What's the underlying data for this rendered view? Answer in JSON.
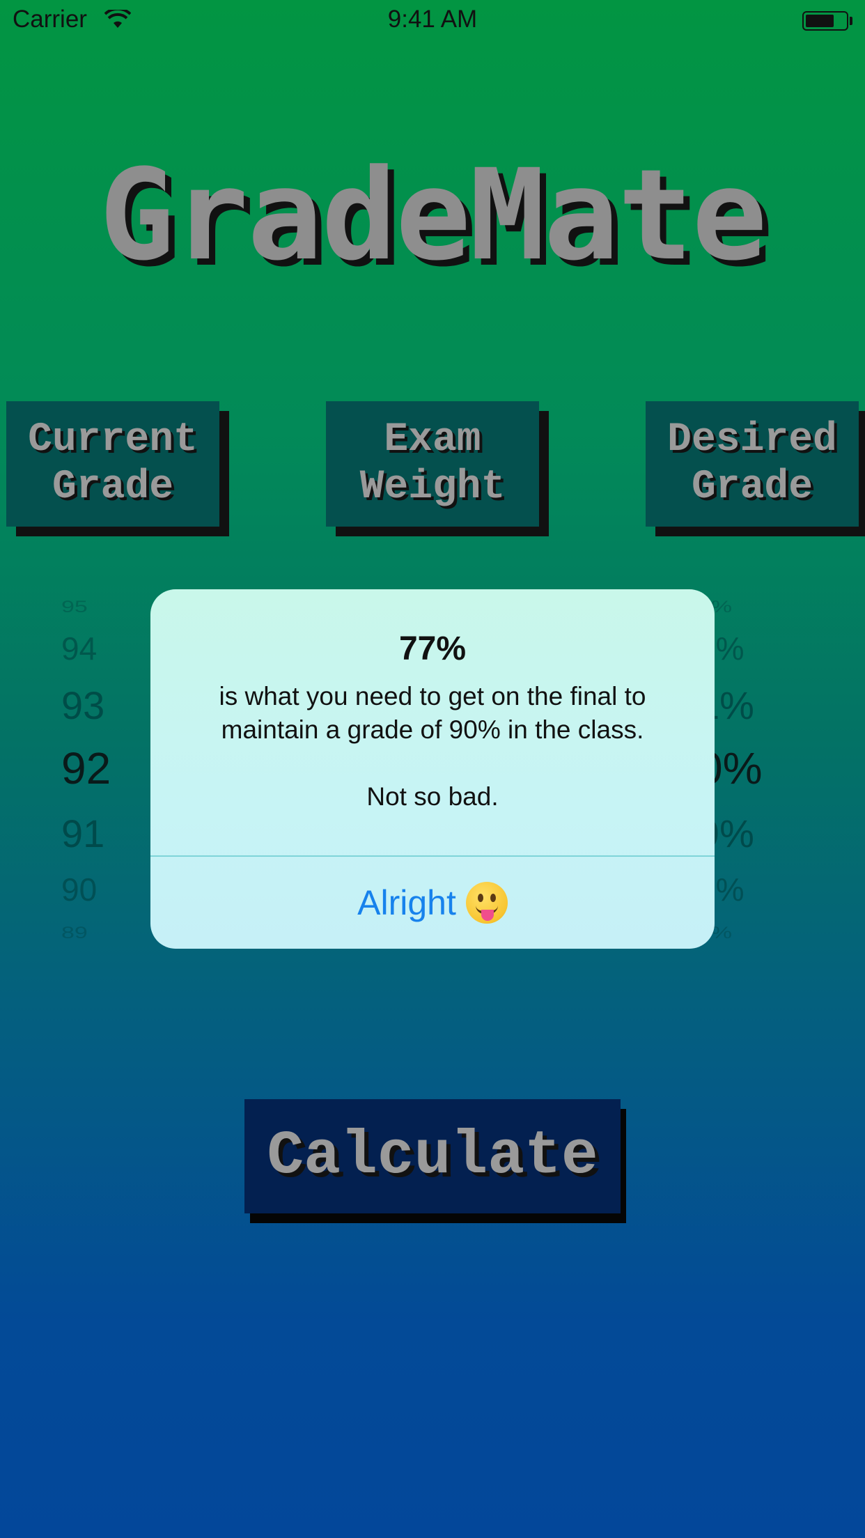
{
  "status_bar": {
    "carrier": "Carrier",
    "time": "9:41 AM"
  },
  "app": {
    "title": "GradeMate"
  },
  "header_buttons": {
    "current_grade": "Current\nGrade",
    "exam_weight": "Exam\nWeight",
    "desired_grade": "Desired\nGrade"
  },
  "pickers": {
    "current_grade": {
      "items": [
        "95",
        "94",
        "93",
        "92",
        "91",
        "90",
        "89"
      ],
      "selected": "92"
    },
    "desired_grade": {
      "items": [
        "3%",
        "2%",
        "1%",
        "0%",
        "9%",
        "8%",
        "7%"
      ],
      "selected": "0%"
    }
  },
  "alert": {
    "title": "77%",
    "message": "is what you need to get on the final to\nmaintain a grade of 90% in the class.\n\nNot so bad.",
    "button_label": "Alright",
    "button_emoji": "face-with-tongue-icon"
  },
  "calculate": {
    "label": "Calculate"
  },
  "colors": {
    "background_top": "#029542",
    "background_bottom": "#03479a",
    "header_button_bg": "#04504e",
    "calculate_bg": "#032050",
    "alert_button_text": "#1782ec"
  }
}
